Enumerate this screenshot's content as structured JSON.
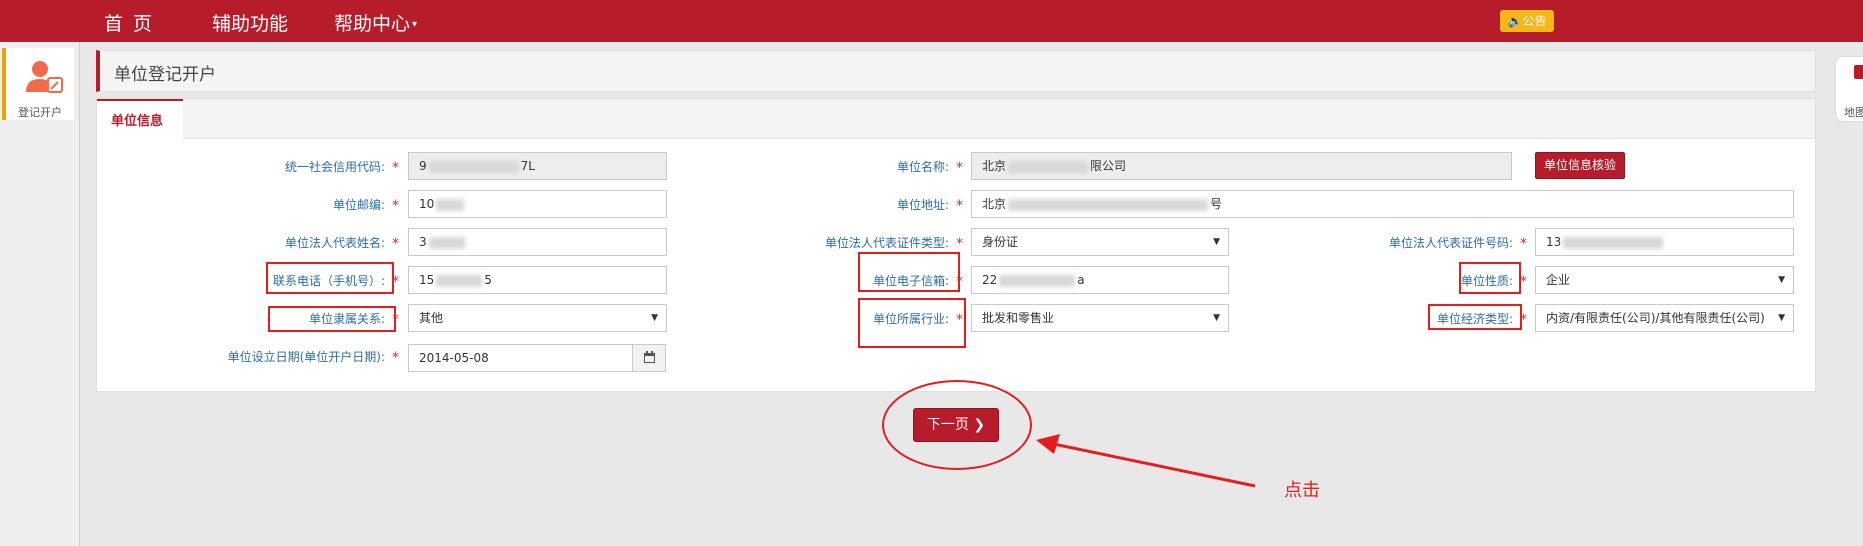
{
  "nav": {
    "home": "首页",
    "aux": "辅助功能",
    "help": "帮助中心",
    "help_caret": "▾",
    "notice": "🔈公告"
  },
  "sidebar": {
    "item_label": "登记开户"
  },
  "right_tab": {
    "label": "地图"
  },
  "panel": {
    "title": "单位登记开户",
    "tab": "单位信息"
  },
  "form": {
    "credit_code": {
      "label": "统一社会信用代码:",
      "value_prefix": "9",
      "value_suffix": "7L"
    },
    "unit_name": {
      "label": "单位名称:",
      "value_prefix": "北京",
      "value_suffix": "限公司"
    },
    "verify_button": "单位信息核验",
    "postcode": {
      "label": "单位邮编:",
      "value_prefix": "10"
    },
    "address": {
      "label": "单位地址:",
      "value_prefix": "北京",
      "value_suffix": "号"
    },
    "legal_name": {
      "label": "单位法人代表姓名:",
      "value_prefix": "3"
    },
    "legal_id_type": {
      "label": "单位法人代表证件类型:",
      "value": "身份证"
    },
    "legal_id_no": {
      "label": "单位法人代表证件号码:",
      "value_prefix": "13"
    },
    "phone": {
      "label": "联系电话（手机号）:",
      "value_prefix": "15",
      "value_suffix": "5"
    },
    "email": {
      "label": "单位电子信箱:",
      "value_prefix": "22",
      "value_suffix": "a"
    },
    "unit_nature": {
      "label": "单位性质:",
      "value": "企业"
    },
    "affiliation": {
      "label": "单位隶属关系:",
      "value": "其他"
    },
    "industry": {
      "label": "单位所属行业:",
      "value": "批发和零售业"
    },
    "economic_type": {
      "label": "单位经济类型:",
      "value": "内资/有限责任(公司)/其他有限责任(公司)"
    },
    "established": {
      "label": "单位设立日期(单位开户日期):",
      "value": "2014-05-08"
    },
    "required_mark": "*"
  },
  "next_button": "下一页",
  "next_icon_glyph": "❯",
  "annotation": {
    "click_text": "点击",
    "color": "#e41e1e"
  },
  "colors": {
    "brand": "#b71c2b",
    "label": "#2e6da4",
    "notice": "#f7b718"
  }
}
